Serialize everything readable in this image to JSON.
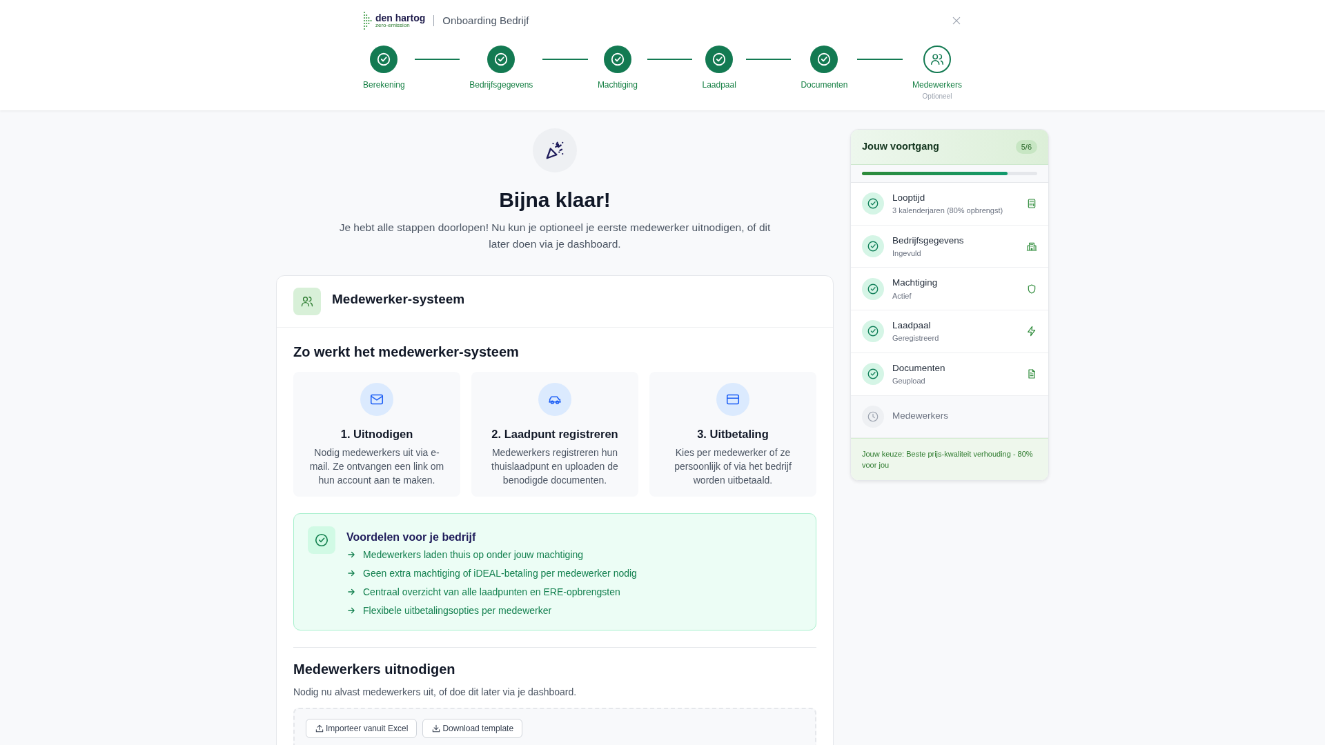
{
  "header": {
    "logo": {
      "name": "den hartog",
      "tagline": "zero-emission"
    },
    "title": "Onboarding Bedrijf"
  },
  "steps": [
    {
      "label": "Berekening",
      "done": true
    },
    {
      "label": "Bedrijfsgegevens",
      "done": true
    },
    {
      "label": "Machtiging",
      "done": true
    },
    {
      "label": "Laadpaal",
      "done": true
    },
    {
      "label": "Documenten",
      "done": true
    },
    {
      "label": "Medewerkers",
      "done": false,
      "note": "Optioneel"
    }
  ],
  "hero": {
    "title": "Bijna klaar!",
    "text": "Je hebt alle stappen doorlopen! Nu kun je optioneel je eerste medewerker uitnodigen, of dit later doen via je dashboard."
  },
  "system_card": {
    "title": "Medewerker-systeem",
    "section_title": "Zo werkt het medewerker-systeem",
    "features": [
      {
        "title": "1. Uitnodigen",
        "text": "Nodig medewerkers uit via e-mail. Ze ontvangen een link om hun account aan te maken."
      },
      {
        "title": "2. Laadpunt registreren",
        "text": "Medewerkers registreren hun thuislaadpunt en uploaden de benodigde documenten."
      },
      {
        "title": "3. Uitbetaling",
        "text": "Kies per medewerker of ze persoonlijk of via het bedrijf worden uitbetaald."
      }
    ],
    "benefits": {
      "title": "Voordelen voor je bedrijf",
      "items": [
        "Medewerkers laden thuis op onder jouw machtiging",
        "Geen extra machtiging of iDEAL-betaling per medewerker nodig",
        "Centraal overzicht van alle laadpunten en ERE-opbrengsten",
        "Flexibele uitbetalingsopties per medewerker"
      ]
    },
    "invite": {
      "title": "Medewerkers uitnodigen",
      "text": "Nodig nu alvast medewerkers uit, of doe dit later via je dashboard.",
      "buttons": [
        "Importeer vanuit Excel",
        "Download template"
      ]
    }
  },
  "progress": {
    "title": "Jouw voortgang",
    "count": "5/6",
    "level": 0.83,
    "items": [
      {
        "label": "Looptijd",
        "detail": "3 kalenderjaren (80% opbrengst)",
        "done": true
      },
      {
        "label": "Bedrijfsgegevens",
        "detail": "Ingevuld",
        "done": true
      },
      {
        "label": "Machtiging",
        "detail": "Actief",
        "done": true
      },
      {
        "label": "Laadpaal",
        "detail": "Geregistreerd",
        "done": true
      },
      {
        "label": "Documenten",
        "detail": "Geupload",
        "done": true
      },
      {
        "label": "Medewerkers",
        "done": false
      }
    ],
    "footer": "Jouw keuze: Beste prijs-kwaliteit verhouding - 80% voor jou"
  }
}
